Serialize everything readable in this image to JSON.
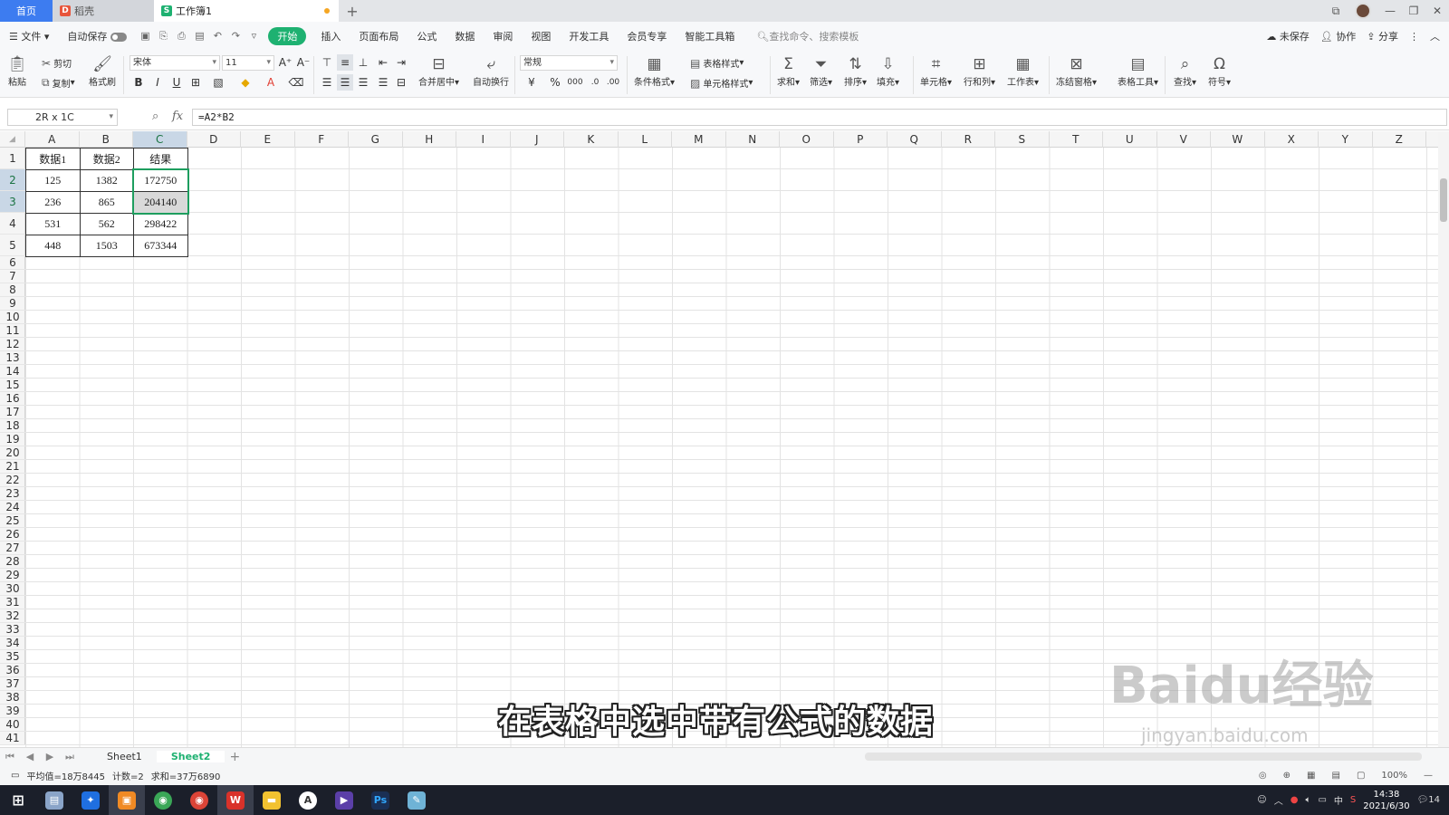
{
  "tabs": {
    "home": "首页",
    "doc": "稻壳",
    "active": "工作簿1"
  },
  "menubar": {
    "file": "文件",
    "autosave": "自动保存",
    "items": [
      "开始",
      "插入",
      "页面布局",
      "公式",
      "数据",
      "审阅",
      "视图",
      "开发工具",
      "会员专享",
      "智能工具箱"
    ],
    "search": "查找命令、搜索模板",
    "unsaved": "未保存",
    "collab": "协作",
    "share": "分享"
  },
  "ribbon": {
    "cut": "剪切",
    "copy": "复制",
    "paste": "粘贴",
    "format_painter": "格式刷",
    "font": "宋体",
    "font_size": "11",
    "merge_center": "合并居中",
    "wrap": "自动换行",
    "number_format": "常规",
    "cond_format": "条件格式",
    "table_style": "表格样式",
    "cell_style": "单元格样式",
    "sum": "求和",
    "filter": "筛选",
    "sort": "排序",
    "fill": "填充",
    "cell": "单元格",
    "row_col": "行和列",
    "worksheet": "工作表",
    "freeze": "冻结窗格",
    "table_tools": "表格工具",
    "find": "查找",
    "symbol": "符号"
  },
  "formula_bar": {
    "name_box": "2R x 1C",
    "fx": "fx",
    "formula": "=A2*B2"
  },
  "columns": [
    "A",
    "B",
    "C",
    "D",
    "E",
    "F",
    "G",
    "H",
    "I",
    "J",
    "K",
    "L",
    "M",
    "N",
    "O",
    "P",
    "Q",
    "R",
    "S",
    "T",
    "U",
    "V",
    "W",
    "X",
    "Y",
    "Z"
  ],
  "rows": [
    "1",
    "2",
    "3",
    "4",
    "5",
    "6",
    "7",
    "8",
    "9",
    "10",
    "11",
    "12",
    "13",
    "14",
    "15",
    "16",
    "17",
    "18",
    "19",
    "20",
    "21",
    "22",
    "23",
    "24",
    "25",
    "26",
    "27",
    "28",
    "29",
    "30",
    "31",
    "32",
    "33",
    "34",
    "35",
    "36",
    "37",
    "38",
    "39",
    "40",
    "41"
  ],
  "table": [
    [
      "数据1",
      "数据2",
      "结果"
    ],
    [
      "125",
      "1382",
      "172750"
    ],
    [
      "236",
      "865",
      "204140"
    ],
    [
      "531",
      "562",
      "298422"
    ],
    [
      "448",
      "1503",
      "673344"
    ]
  ],
  "sheets": [
    "Sheet1",
    "Sheet2"
  ],
  "status": {
    "avg": "平均值=18万8445",
    "count": "计数=2",
    "sum": "求和=37万6890",
    "zoom": "100%"
  },
  "taskbar": {
    "time": "14:38",
    "date": "2021/6/30",
    "lang": "中",
    "notif": "14"
  },
  "overlay": {
    "caption": "在表格中选中带有公式的数据",
    "watermark": "Baidu经验",
    "watermark_url": "jingyan.baidu.com"
  }
}
